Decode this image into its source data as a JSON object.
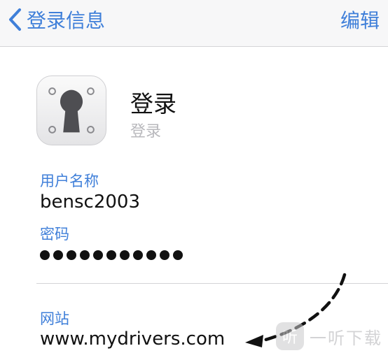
{
  "navbar": {
    "back_label": "登录信息",
    "edit_label": "编辑",
    "accent_color": "#3f7fd9"
  },
  "header": {
    "title": "登录",
    "subtitle": "登录",
    "icon": "keychain-lock-icon"
  },
  "fields": {
    "username_label": "用户名称",
    "username_value": "bensc2003",
    "password_label": "密码",
    "password_masked": "●●●●●●●●●●●",
    "website_label": "网站",
    "website_value": "www.mydrivers.com"
  },
  "watermark": {
    "badge": "听",
    "text": "一听下载"
  }
}
